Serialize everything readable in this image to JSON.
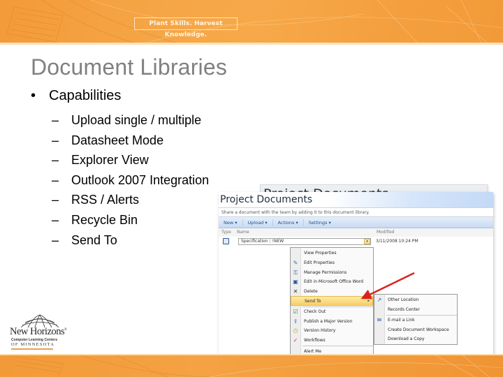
{
  "header": {
    "tagline": "Plant Skills. Harvest Knowledge.",
    "accent_color": "#f5a545"
  },
  "slide": {
    "title": "Document Libraries",
    "bullet": "Capabilities",
    "bullet_glyph": "•",
    "dash_glyph": "–",
    "sub_items": [
      "Upload single / multiple",
      "Datasheet Mode",
      "Explorer View",
      "Outlook 2007 Integration",
      "RSS / Alerts",
      "Recycle Bin",
      "Send To"
    ]
  },
  "logo": {
    "brand": "New Horizons",
    "trademark": "®",
    "line1": "Computer Learning Centers",
    "line2": "OF MINNESOTA"
  },
  "screenshot": {
    "back_title": "Project Documents",
    "library_title": "Project Documents",
    "description": "Share a document with the team by adding it to this document library.",
    "toolbar": [
      {
        "label": "New",
        "caret": "▾"
      },
      {
        "label": "Upload",
        "caret": "▾"
      },
      {
        "label": "Actions",
        "caret": "▾"
      },
      {
        "label": "Settings",
        "caret": "▾"
      }
    ],
    "columns": {
      "type": "Type",
      "name": "Name",
      "modified": "Modified"
    },
    "row": {
      "name": "Specification",
      "badge": "!NEW",
      "dropdown_glyph": "▾",
      "modified": "3/11/2008 10:24 PM"
    },
    "context_menu": [
      {
        "label": "View Properties",
        "icon": ""
      },
      {
        "label": "Edit Properties",
        "icon": "edit-properties-icon"
      },
      {
        "label": "Manage Permissions",
        "icon": "permissions-icon"
      },
      {
        "label": "Edit in Microsoft Office Word",
        "icon": "word-icon"
      },
      {
        "label": "Delete",
        "icon": "delete-icon"
      },
      {
        "label": "Send To",
        "icon": "",
        "highlighted": true,
        "submenu_glyph": "▸"
      },
      {
        "label": "Check Out",
        "icon": "check-out-icon"
      },
      {
        "label": "Publish a Major Version",
        "icon": "publish-icon"
      },
      {
        "label": "Version History",
        "icon": "version-history-icon"
      },
      {
        "label": "Workflows",
        "icon": "workflows-icon"
      },
      {
        "label": "Alert Me",
        "icon": ""
      }
    ],
    "send_to_submenu": [
      {
        "label": "Other Location",
        "icon": "other-location-icon"
      },
      {
        "label": "Records Center",
        "icon": ""
      },
      {
        "label": "E-mail a Link",
        "icon": "email-link-icon"
      },
      {
        "label": "Create Document Workspace",
        "icon": ""
      },
      {
        "label": "Download a Copy",
        "icon": ""
      }
    ],
    "annotation_arrow_color": "#d9241c"
  }
}
